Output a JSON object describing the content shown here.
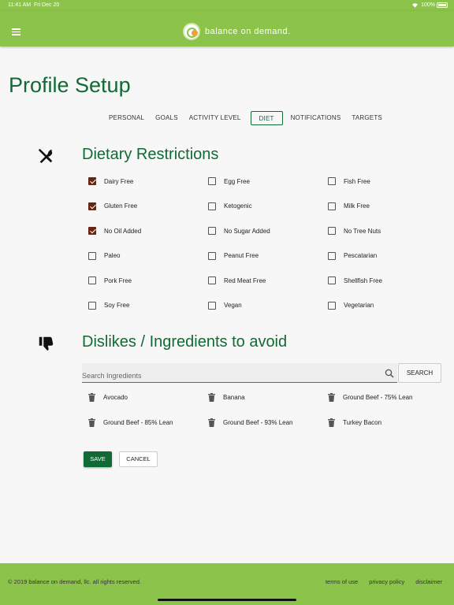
{
  "status_bar": {
    "time": "11:41 AM",
    "date": "Fri Dec 20",
    "battery": "100%"
  },
  "header": {
    "brand": "balance on demand."
  },
  "page": {
    "title": "Profile Setup"
  },
  "tabs": [
    {
      "label": "PERSONAL",
      "active": false
    },
    {
      "label": "GOALS",
      "active": false
    },
    {
      "label": "ACTIVITY LEVEL",
      "active": false
    },
    {
      "label": "DIET",
      "active": true
    },
    {
      "label": "NOTIFICATIONS",
      "active": false
    },
    {
      "label": "TARGETS",
      "active": false
    }
  ],
  "dietary": {
    "title": "Dietary Restrictions",
    "icon": "utensils-icon",
    "items": [
      {
        "label": "Dairy Free",
        "checked": true
      },
      {
        "label": "Egg Free",
        "checked": false
      },
      {
        "label": "Fish Free",
        "checked": false
      },
      {
        "label": "Gluten Free",
        "checked": true
      },
      {
        "label": "Ketogenic",
        "checked": false
      },
      {
        "label": "Milk Free",
        "checked": false
      },
      {
        "label": "No Oil Added",
        "checked": true
      },
      {
        "label": "No Sugar Added",
        "checked": false
      },
      {
        "label": "No Tree Nuts",
        "checked": false
      },
      {
        "label": "Paleo",
        "checked": false
      },
      {
        "label": "Peanut Free",
        "checked": false
      },
      {
        "label": "Pescatarian",
        "checked": false
      },
      {
        "label": "Pork Free",
        "checked": false
      },
      {
        "label": "Red Meat Free",
        "checked": false
      },
      {
        "label": "Shellfish Free",
        "checked": false
      },
      {
        "label": "Soy Free",
        "checked": false
      },
      {
        "label": "Vegan",
        "checked": false
      },
      {
        "label": "Vegetarian",
        "checked": false
      }
    ]
  },
  "dislikes": {
    "title": "Dislikes / Ingredients to avoid",
    "icon": "thumbs-down-icon",
    "search_placeholder": "Search Ingredients",
    "search_button": "SEARCH",
    "items": [
      "Avocado",
      "Banana",
      "Ground Beef - 75% Lean",
      "Ground Beef - 85% Lean",
      "Ground Beef - 93% Lean",
      "Turkey Bacon"
    ]
  },
  "actions": {
    "save": "SAVE",
    "cancel": "CANCEL"
  },
  "footer": {
    "copyright": "© 2019 balance on demand, llc. all rights reserved.",
    "links": [
      "terms of use",
      "privacy policy",
      "disclaimer"
    ]
  },
  "colors": {
    "brand_green": "#8cc34a",
    "title_green": "#0f6b33",
    "checked": "#6b2410"
  }
}
